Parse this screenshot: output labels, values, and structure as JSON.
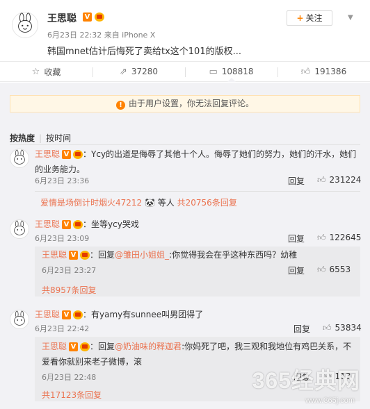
{
  "post": {
    "author": "王思聪",
    "vip_label": "V",
    "meta": "6月23日 22:32 来自 iPhone X",
    "text": "韩国mnet估计后悔死了卖给tx这个101的版权...",
    "follow_label": "关注"
  },
  "actions": [
    {
      "icon": "star-icon",
      "label": "收藏"
    },
    {
      "icon": "share-icon",
      "label": "37280"
    },
    {
      "icon": "comment-icon",
      "label": "108818"
    },
    {
      "icon": "thumb-up-icon",
      "label": "191386"
    }
  ],
  "notice": "由于用户设置，你无法回复评论。",
  "sort": {
    "hot": "按热度",
    "time": "按时间"
  },
  "comments": [
    {
      "author": "王思聪",
      "colon": "：",
      "text": "Ycy的出道是侮辱了其他十个人。侮辱了她们的努力，她们的汗水，她们的业务能力。",
      "time": "6月23日 23:36",
      "reply": "回复",
      "likes": "231224",
      "summary_user": "爱情是场倒计时烟火47212",
      "summary_emoji": "🐼",
      "summary_mid": "等人",
      "summary_count": "共20756条回复"
    },
    {
      "author": "王思聪",
      "colon": "：",
      "text": "坐等ycy哭戏",
      "time": "6月23日 23:09",
      "reply": "回复",
      "likes": "122645",
      "sub": {
        "author": "王思聪",
        "colon": "：",
        "prefix": "回复",
        "mention": "@雏田小姐姐_",
        "text": ":你觉得我会在乎这种东西吗？幼稚",
        "time": "6月23日 23:27",
        "reply": "回复",
        "likes": "6553"
      },
      "summary_count": "共8957条回复"
    },
    {
      "author": "王思聪",
      "colon": "：",
      "text": "有yamy有sunnee叫男团得了",
      "time": "6月23日 22:42",
      "reply": "回复",
      "likes": "53834",
      "sub": {
        "author": "王思聪",
        "colon": "：",
        "prefix": "回复",
        "mention": "@奶油味的释迦君",
        "text": ":你妈死了吧，我三观和我地位有鸡巴关系，不爱看你就别来老子微博，滚",
        "time": "6月23日 22:48",
        "reply": "回复",
        "likes": "113"
      },
      "summary_count": "共17123条回复"
    }
  ],
  "watermark": {
    "main": "365经典网",
    "sub": "www.365j.com"
  },
  "colors": {
    "accent": "#eb7350",
    "orange": "#ff8200",
    "bg": "#f2f2f5"
  }
}
